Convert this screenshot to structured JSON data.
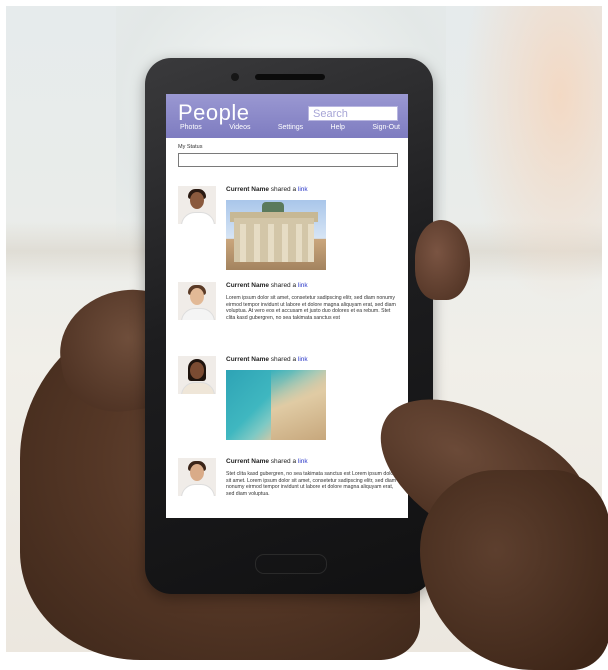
{
  "app": {
    "title": "People",
    "search_placeholder": "Search",
    "accent_color": "#8a88c9"
  },
  "nav": {
    "items": [
      {
        "label": "Photos"
      },
      {
        "label": "Videos"
      },
      {
        "label": "Settings"
      },
      {
        "label": "Help"
      },
      {
        "label": "Sign-Out"
      }
    ]
  },
  "status": {
    "label": "My Status",
    "value": ""
  },
  "posts": [
    {
      "name": "Current Name",
      "action": "shared a",
      "link": "link",
      "text": "",
      "media": "city-gate-photo"
    },
    {
      "name": "Current Name",
      "action": "shared a",
      "link": "link",
      "text": "Lorem ipsum dolor sit amet, consetetur sadipscing elitr, sed diam nonumy eirmod tempor invidunt ut labore et dolore magna aliquyam erat, sed diam voluptua. At vero eos et accusam et justo duo dolores et ea rebum. Stet clita kasd gubergren, no sea takimata sanctus est",
      "media": ""
    },
    {
      "name": "Current Name",
      "action": "shared a",
      "link": "link",
      "text": "",
      "media": "beach-photo"
    },
    {
      "name": "Current Name",
      "action": "shared a",
      "link": "link",
      "text": "Stet clita kasd gubergren, no sea takimata sanctus est Lorem ipsum dolor sit amet. Lorem ipsum dolor sit amet, consetetur sadipscing elitr, sed diam nonumy eirmod tempor invidunt ut labore et dolore magna aliquyam erat, sed diam voluptua.",
      "media": ""
    }
  ]
}
